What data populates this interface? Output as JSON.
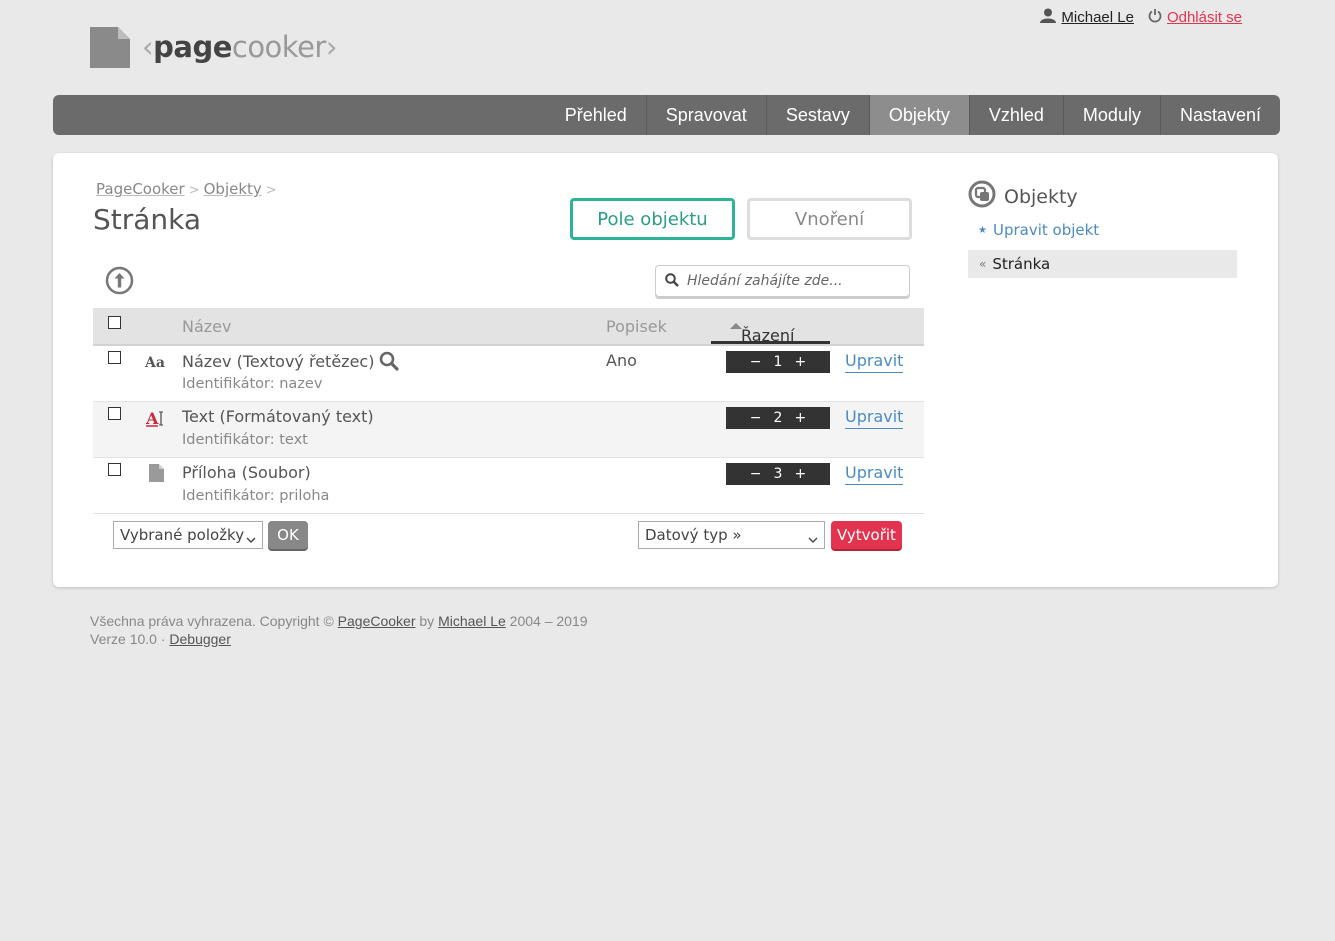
{
  "logo": {
    "pre": "‹",
    "bold": "page",
    "light": "cooker",
    "post": "›"
  },
  "user": {
    "name": "Michael Le",
    "logout": "Odhlásit se"
  },
  "nav": [
    "Přehled",
    "Spravovat",
    "Sestavy",
    "Objekty",
    "Vzhled",
    "Moduly",
    "Nastavení"
  ],
  "nav_active": "Objekty",
  "breadcrumb": [
    "PageCooker",
    "Objekty"
  ],
  "breadcrumb_sep": ">",
  "title": "Stránka",
  "buttons": {
    "fields": "Pole objektu",
    "nesting": "Vnoření"
  },
  "search": {
    "placeholder": "Hledání zahájíte zde..."
  },
  "table": {
    "headers": {
      "name": "Název",
      "label": "Popisek",
      "order": "Řazení"
    },
    "rows": [
      {
        "name": "Název (Textový řetězec)",
        "id": "Identifikátor: nazev",
        "label": "Ano",
        "order": "1",
        "icon": "text-string-icon"
      },
      {
        "name": "Text (Formátovaný text)",
        "id": "Identifikátor: text",
        "label": "",
        "order": "2",
        "icon": "formatted-text-icon"
      },
      {
        "name": "Příloha (Soubor)",
        "id": "Identifikátor: priloha",
        "label": "",
        "order": "3",
        "icon": "file-icon"
      }
    ],
    "order_minus": "−",
    "order_plus": "+",
    "edit_label": "Upravit"
  },
  "footer_actions": {
    "bulk_select": "Vybrané položky",
    "ok": "OK",
    "type_select": "Datový typ »",
    "create": "Vytvořit"
  },
  "sidebar": {
    "title": "Objekty",
    "link": "Upravit objekt",
    "current": "Stránka"
  },
  "footer": {
    "copyright_prefix": "Všechna práva vyhrazena. Copyright ©",
    "product": "PageCooker",
    "by": "by",
    "author": "Michael Le",
    "years": "2004 – 2019",
    "version": "Verze 10.0",
    "dot": "·",
    "debugger": "Debugger"
  },
  "colors": {
    "accent": "#2db396",
    "danger": "#e2334f",
    "link": "#4b8bc2",
    "nav": "#6b6b6b"
  }
}
